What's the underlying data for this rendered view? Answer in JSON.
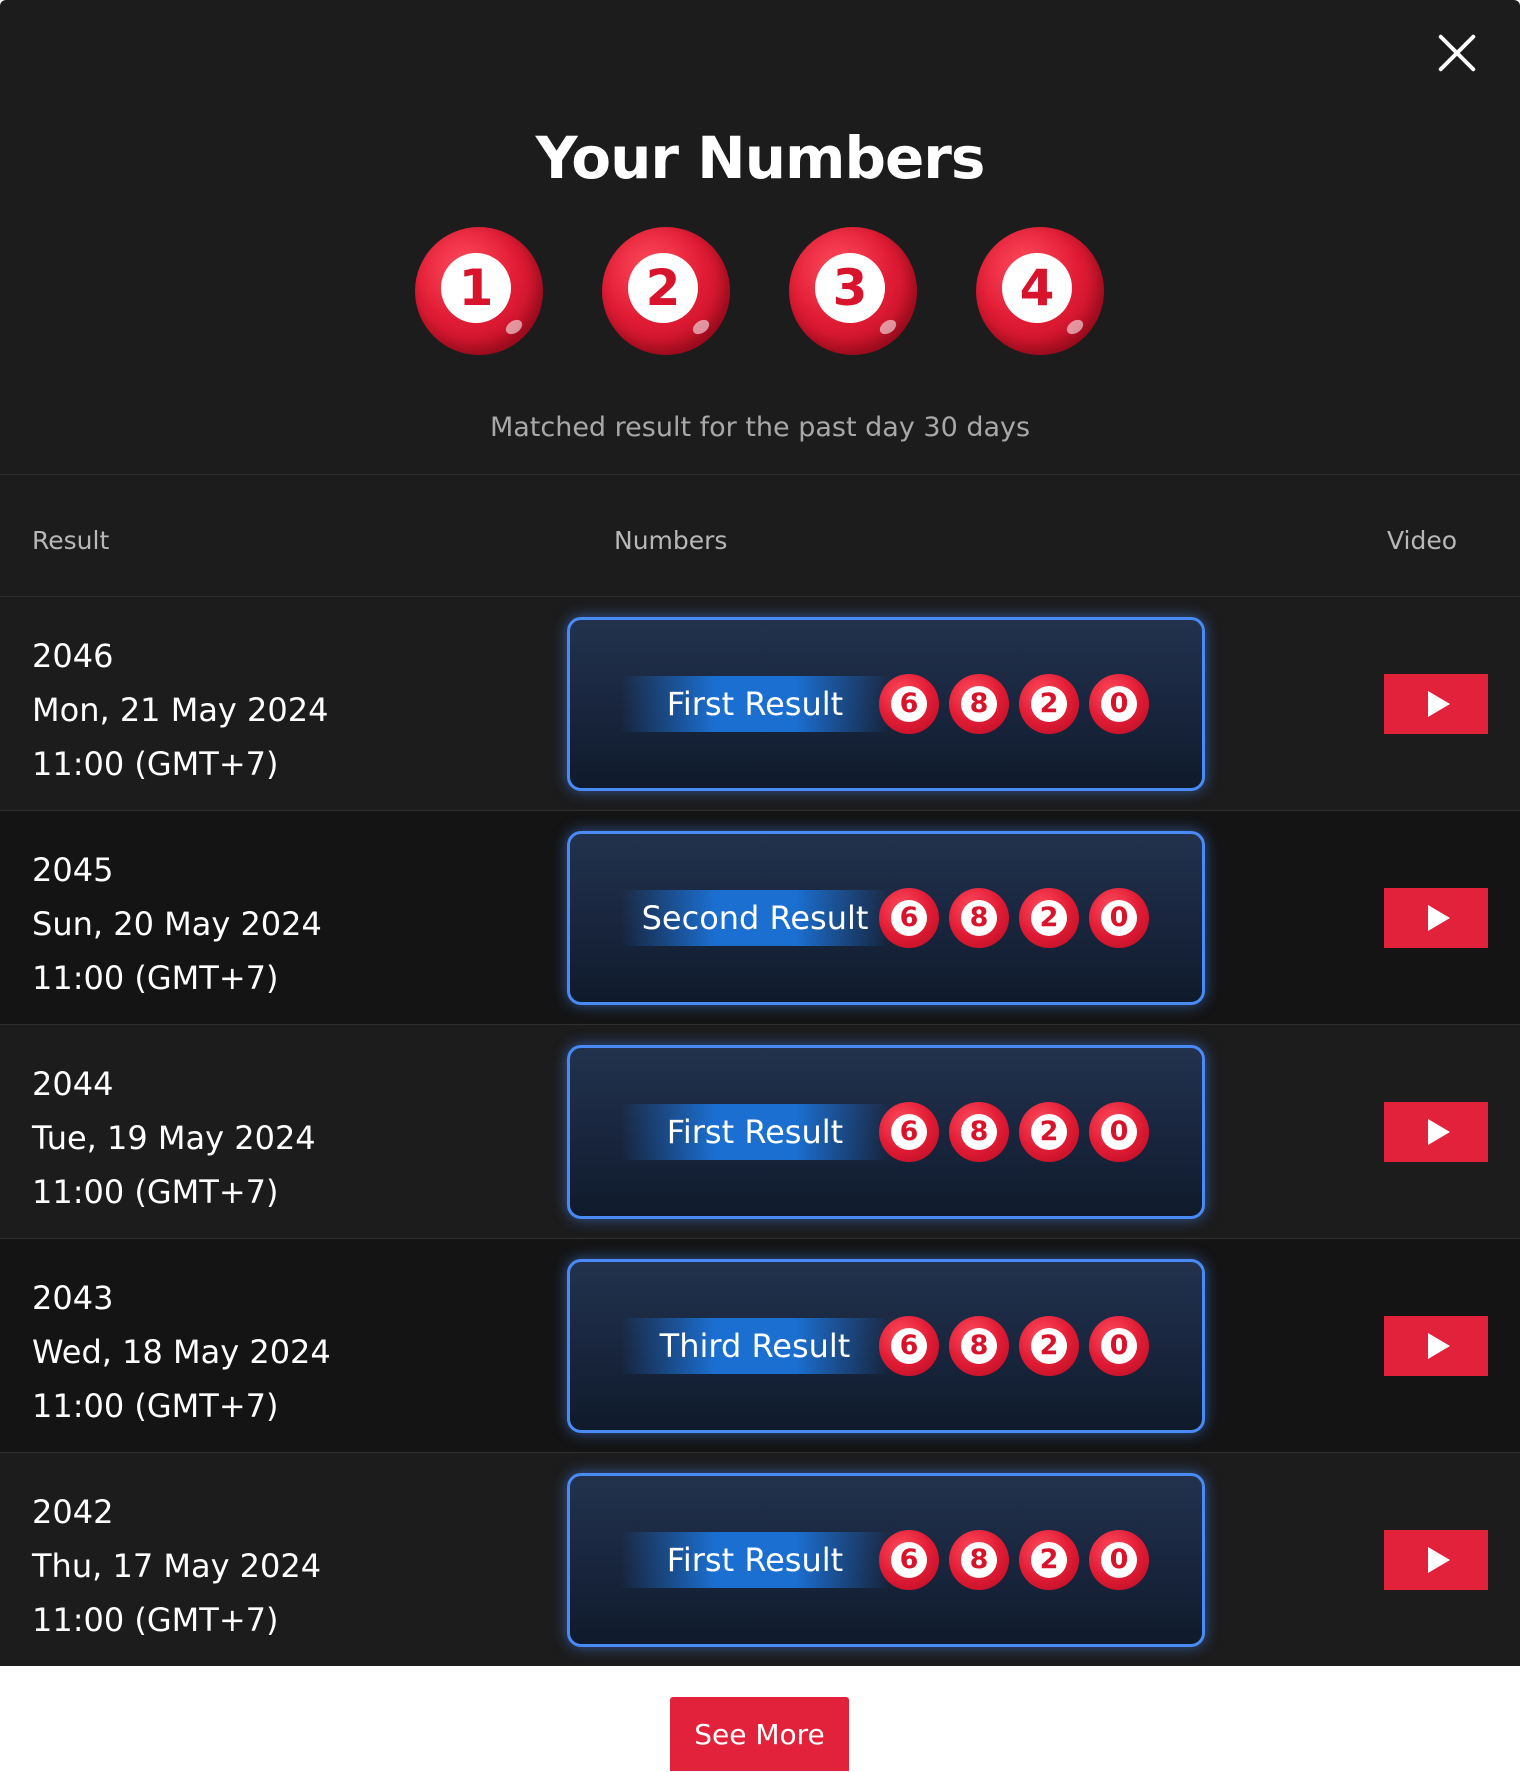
{
  "modal": {
    "title": "Your Numbers",
    "selected_numbers": [
      "1",
      "2",
      "3",
      "4"
    ],
    "subtitle": "Matched result for the past day 30 days"
  },
  "table": {
    "headers": {
      "result": "Result",
      "numbers": "Numbers",
      "video": "Video"
    },
    "rows": [
      {
        "draw": "2046",
        "date": "Mon, 21 May 2024",
        "time": "11:00 (GMT+7)",
        "result_label": "First Result",
        "numbers": [
          "6",
          "8",
          "2",
          "0"
        ]
      },
      {
        "draw": "2045",
        "date": "Sun, 20 May 2024",
        "time": "11:00 (GMT+7)",
        "result_label": "Second Result",
        "numbers": [
          "6",
          "8",
          "2",
          "0"
        ]
      },
      {
        "draw": "2044",
        "date": "Tue, 19 May 2024",
        "time": "11:00 (GMT+7)",
        "result_label": "First Result",
        "numbers": [
          "6",
          "8",
          "2",
          "0"
        ]
      },
      {
        "draw": "2043",
        "date": "Wed, 18 May 2024",
        "time": "11:00 (GMT+7)",
        "result_label": "Third Result",
        "numbers": [
          "6",
          "8",
          "2",
          "0"
        ]
      },
      {
        "draw": "2042",
        "date": "Thu, 17 May 2024",
        "time": "11:00 (GMT+7)",
        "result_label": "First Result",
        "numbers": [
          "6",
          "8",
          "2",
          "0"
        ]
      }
    ]
  },
  "see_more_label": "See More",
  "icons": {
    "close": "close-icon",
    "play": "play-icon"
  },
  "colors": {
    "background": "#1c1c1d",
    "accent_red": "#e2213a",
    "card_border": "#4a8af5",
    "label_blue": "#1b6fd0"
  }
}
